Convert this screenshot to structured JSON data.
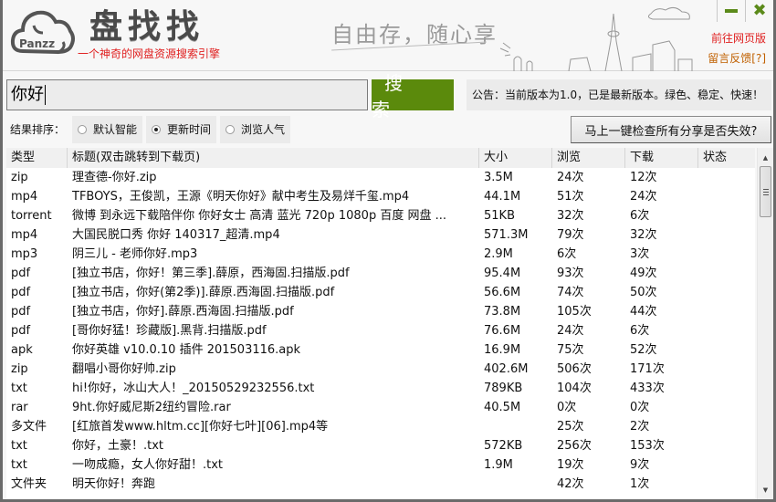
{
  "header": {
    "logo_text": "Panzz",
    "app_title": "盘找找",
    "app_subtitle": "一个神奇的网盘资源搜索引擎",
    "slogan": "自由存，随心享",
    "web_version_link": "前往网页版",
    "feedback_link": "留言反馈[?]",
    "minimize_icon": "minimize-icon",
    "close_icon": "close-icon"
  },
  "search": {
    "value": "你好",
    "button_label": "搜 索"
  },
  "notice": "公告：当前版本为1.0，已是最新版本。绿色、稳定、快速！",
  "sort": {
    "label": "结果排序：",
    "options": [
      {
        "label": "默认智能",
        "checked": false
      },
      {
        "label": "更新时间",
        "checked": true
      },
      {
        "label": "浏览人气",
        "checked": false
      }
    ]
  },
  "check_button": "马上一键检查所有分享是否失效?",
  "table": {
    "columns": [
      "类型",
      "标题(双击跳转到下载页)",
      "大小",
      "浏览",
      "下载",
      "状态"
    ],
    "rows": [
      {
        "type": "zip",
        "title": "理查德-你好.zip",
        "size": "3.5M",
        "views": "24次",
        "downloads": "12次",
        "status": ""
      },
      {
        "type": "mp4",
        "title": "TFBOYS，王俊凯，王源《明天你好》献中考生及易烊千玺.mp4",
        "size": "44.1M",
        "views": "51次",
        "downloads": "24次",
        "status": ""
      },
      {
        "type": "torrent",
        "title": "微博 到永远下载陪伴你 你好女士 高清 蓝光 720p 1080p 百度 网盘 ...",
        "size": "51KB",
        "views": "32次",
        "downloads": "6次",
        "status": ""
      },
      {
        "type": "mp4",
        "title": "大国民脱口秀 你好 140317_超清.mp4",
        "size": "571.3M",
        "views": "79次",
        "downloads": "32次",
        "status": ""
      },
      {
        "type": "mp3",
        "title": "阴三儿 - 老师你好.mp3",
        "size": "2.9M",
        "views": "6次",
        "downloads": "3次",
        "status": ""
      },
      {
        "type": "pdf",
        "title": "[独立书店，你好！第三季].薛原，西海固.扫描版.pdf",
        "size": "95.4M",
        "views": "93次",
        "downloads": "49次",
        "status": ""
      },
      {
        "type": "pdf",
        "title": "[独立书店，你好(第2季)].薛原.西海固.扫描版.pdf",
        "size": "56.6M",
        "views": "74次",
        "downloads": "50次",
        "status": ""
      },
      {
        "type": "pdf",
        "title": "[独立书店，你好].薛原.西海固.扫描版.pdf",
        "size": "73.8M",
        "views": "105次",
        "downloads": "44次",
        "status": ""
      },
      {
        "type": "pdf",
        "title": "[哥你好猛！珍藏版].黑背.扫描版.pdf",
        "size": "76.6M",
        "views": "24次",
        "downloads": "6次",
        "status": ""
      },
      {
        "type": "apk",
        "title": "你好英雄 v10.0.10 插件 201503116.apk",
        "size": "16.9M",
        "views": "75次",
        "downloads": "52次",
        "status": ""
      },
      {
        "type": "zip",
        "title": "翻唱小哥你好帅.zip",
        "size": "402.6M",
        "views": "506次",
        "downloads": "171次",
        "status": ""
      },
      {
        "type": "txt",
        "title": "hi!你好，冰山大人！_20150529232556.txt",
        "size": "789KB",
        "views": "104次",
        "downloads": "433次",
        "status": ""
      },
      {
        "type": "rar",
        "title": "9ht.你好威尼斯2纽约冒险.rar",
        "size": "40.5M",
        "views": "0次",
        "downloads": "0次",
        "status": ""
      },
      {
        "type": "多文件",
        "title": "[红旅首发www.hltm.cc][你好七叶][06].mp4等",
        "size": "",
        "views": "25次",
        "downloads": "2次",
        "status": ""
      },
      {
        "type": "txt",
        "title": "你好，土豪！.txt",
        "size": "572KB",
        "views": "256次",
        "downloads": "153次",
        "status": ""
      },
      {
        "type": "txt",
        "title": "一吻成瘾，女人你好甜！.txt",
        "size": "1.9M",
        "views": "19次",
        "downloads": "9次",
        "status": ""
      },
      {
        "type": "文件夹",
        "title": "明天你好！奔跑",
        "size": "",
        "views": "42次",
        "downloads": "1次",
        "status": ""
      }
    ]
  }
}
